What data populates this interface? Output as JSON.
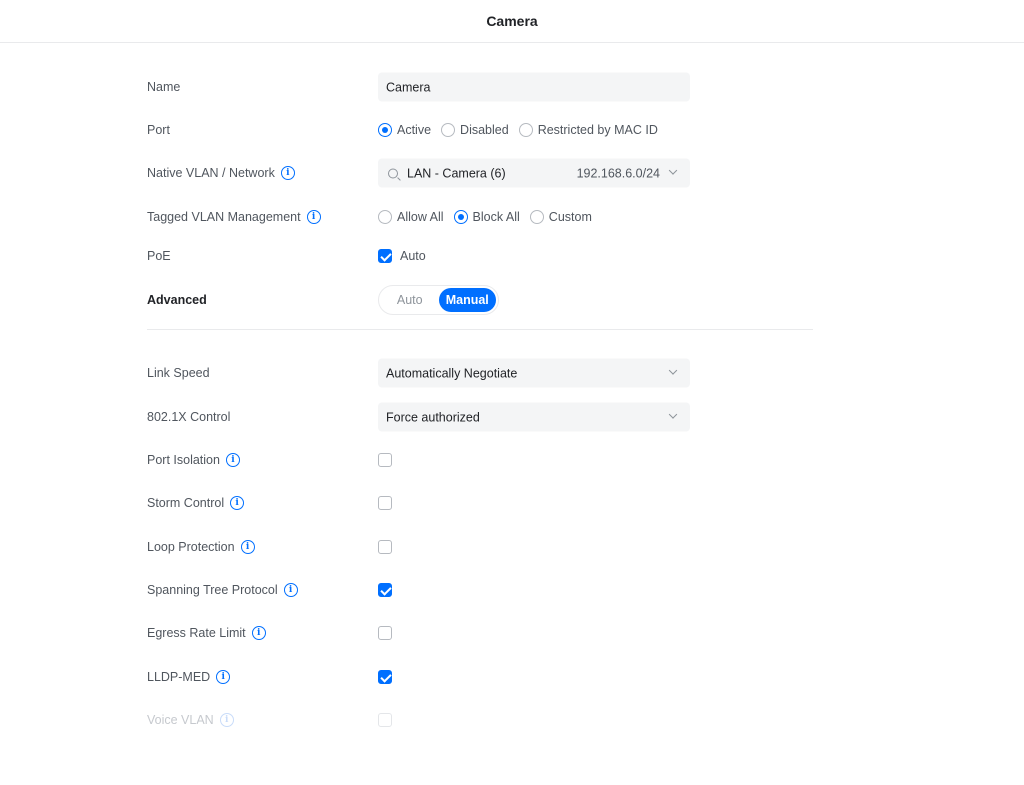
{
  "header": {
    "title": "Camera"
  },
  "fields": {
    "name": {
      "label": "Name",
      "value": "Camera"
    },
    "port": {
      "label": "Port",
      "options": [
        "Active",
        "Disabled",
        "Restricted by MAC ID"
      ],
      "selected": "Active"
    },
    "native_vlan": {
      "label": "Native VLAN / Network",
      "value": "LAN - Camera (6)",
      "subnet": "192.168.6.0/24"
    },
    "tagged_vlan": {
      "label": "Tagged VLAN Management",
      "options": [
        "Allow All",
        "Block All",
        "Custom"
      ],
      "selected": "Block All"
    },
    "poe": {
      "label": "PoE",
      "option": "Auto",
      "checked": true
    },
    "advanced": {
      "label": "Advanced",
      "options": [
        "Auto",
        "Manual"
      ],
      "selected": "Manual"
    },
    "link_speed": {
      "label": "Link Speed",
      "value": "Automatically Negotiate"
    },
    "dot1x": {
      "label": "802.1X Control",
      "value": "Force authorized"
    },
    "port_isolation": {
      "label": "Port Isolation",
      "checked": false
    },
    "storm_control": {
      "label": "Storm Control",
      "checked": false
    },
    "loop_protection": {
      "label": "Loop Protection",
      "checked": false
    },
    "spanning_tree": {
      "label": "Spanning Tree Protocol",
      "checked": true
    },
    "egress_rate_limit": {
      "label": "Egress Rate Limit",
      "checked": false
    },
    "lldp_med": {
      "label": "LLDP-MED",
      "checked": true
    },
    "voice_vlan": {
      "label": "Voice VLAN",
      "checked": false,
      "disabled": true
    }
  },
  "colors": {
    "accent": "#006fff",
    "text": "#50565e",
    "heading": "#212327",
    "field_bg": "#f4f5f6"
  },
  "icons": {
    "info": "info-icon",
    "search": "search-icon",
    "chevron": "chevron-down-icon"
  }
}
